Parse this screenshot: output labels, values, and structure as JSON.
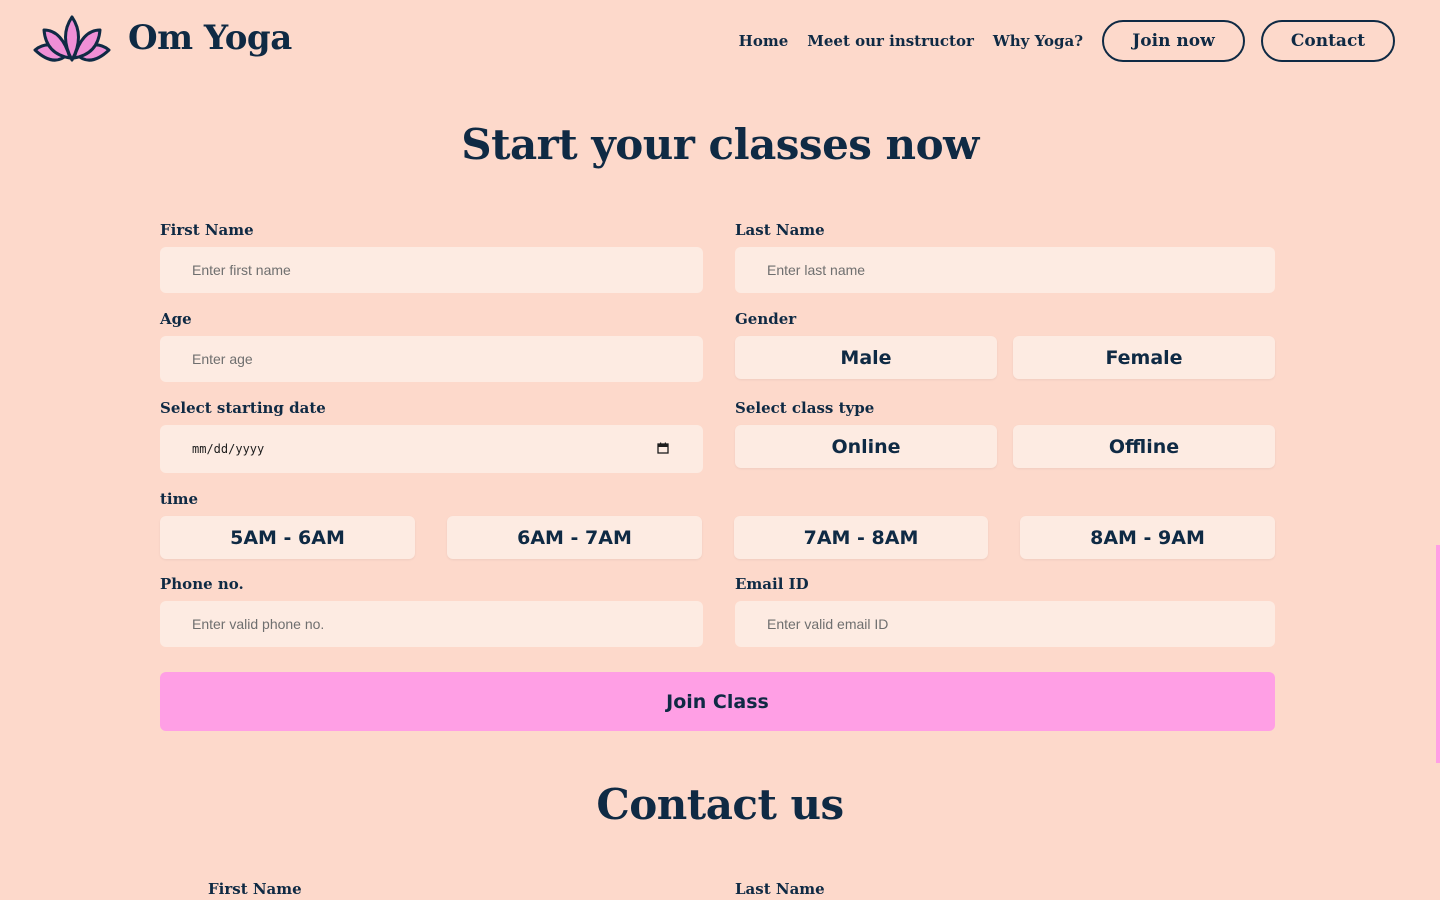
{
  "colors": {
    "background": "#fdd9cb",
    "text": "#0f2a44",
    "field": "#fdebe2",
    "accent": "#ff9fe5"
  },
  "header": {
    "logo_icon": "lotus-icon",
    "brand": "Om Yoga",
    "nav": {
      "home": "Home",
      "instructor": "Meet our instructor",
      "why": "Why Yoga?"
    },
    "join_now": "Join now",
    "contact": "Contact"
  },
  "form": {
    "title": "Start your classes now",
    "first_name": {
      "label": "First Name",
      "placeholder": "Enter first name"
    },
    "last_name": {
      "label": "Last Name",
      "placeholder": "Enter last name"
    },
    "age": {
      "label": "Age",
      "placeholder": "Enter age"
    },
    "gender": {
      "label": "Gender",
      "options": [
        "Male",
        "Female"
      ]
    },
    "date": {
      "label": "Select starting date",
      "placeholder": "mm/dd/yyyy",
      "icon": "calendar-icon"
    },
    "class_type": {
      "label": "Select class type",
      "options": [
        "Online",
        "Offline"
      ]
    },
    "time": {
      "label": "time",
      "options": [
        "5AM - 6AM",
        "6AM - 7AM",
        "7AM - 8AM",
        "8AM - 9AM"
      ]
    },
    "phone": {
      "label": "Phone no.",
      "placeholder": "Enter valid phone no."
    },
    "email": {
      "label": "Email ID",
      "placeholder": "Enter valid email ID"
    },
    "submit": "Join Class"
  },
  "contact": {
    "title": "Contact us",
    "first_name_label": "First Name",
    "last_name_label": "Last Name"
  }
}
